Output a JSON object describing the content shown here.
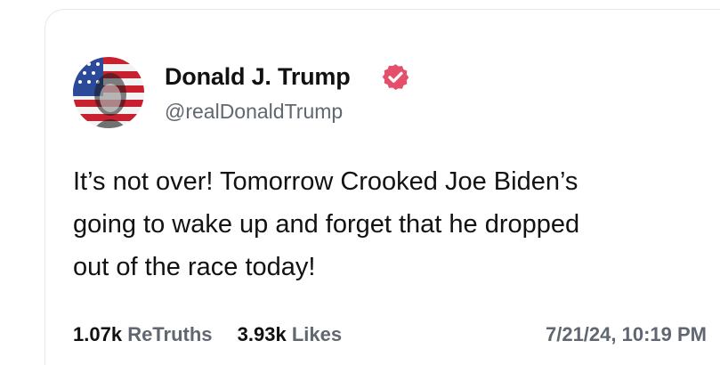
{
  "post": {
    "author": {
      "name": "Donald J. Trump",
      "handle": "@realDonaldTrump",
      "avatar_icon": "flag-portrait-avatar",
      "verified_icon": "verified-badge-icon",
      "verified_color": "#e4506c"
    },
    "body_lines": [
      "It’s not over! Tomorrow Crooked Joe Biden’s",
      "going to wake up and forget that he dropped",
      "out of the race today!"
    ],
    "stats": {
      "retruths_count": "1.07k",
      "retruths_label": "ReTruths",
      "likes_count": "3.93k",
      "likes_label": "Likes"
    },
    "timestamp": "7/21/24, 10:19 PM"
  }
}
